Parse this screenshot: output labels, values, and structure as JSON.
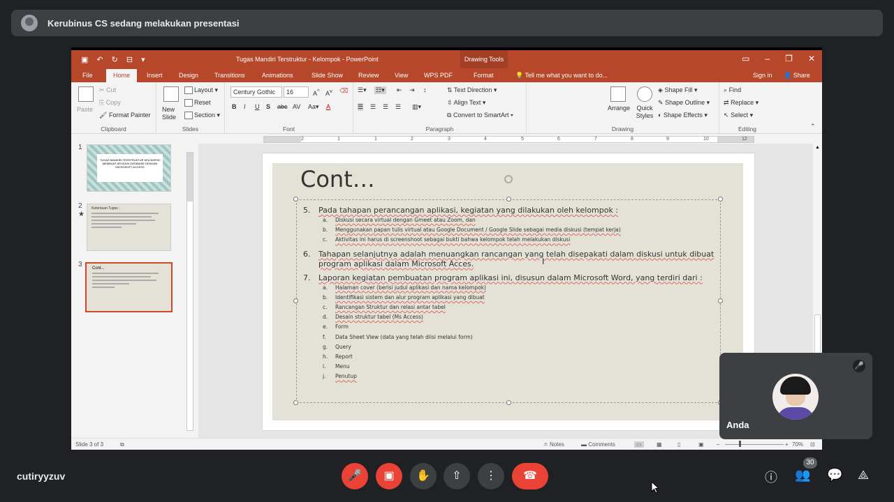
{
  "meet": {
    "presenting_banner": "Kerubinus CS sedang melakukan presentasi",
    "self_name": "Anda",
    "user_label": "cutiryyzuv",
    "participants_count": "30"
  },
  "ppt": {
    "doc_title": "Tugas Mandiri Terstruktur - Kelompok - PowerPoint",
    "context_tab": "Drawing Tools",
    "tabs": [
      "File",
      "Home",
      "Insert",
      "Design",
      "Transitions",
      "Animations",
      "Slide Show",
      "Review",
      "View",
      "WPS PDF",
      "Format"
    ],
    "tell_me": "Tell me what you want to do...",
    "sign_in": "Sign in",
    "share": "Share",
    "ribbon": {
      "paste": "Paste",
      "cut": "Cut",
      "copy": "Copy",
      "format_painter": "Format Painter",
      "clipboard": "Clipboard",
      "new_slide": "New Slide",
      "layout": "Layout",
      "reset": "Reset",
      "section": "Section",
      "slides": "Slides",
      "font_name": "Century Gothic",
      "font_size": "16",
      "font": "Font",
      "text_direction": "Text Direction",
      "align_text": "Align Text",
      "convert_smartart": "Convert to SmartArt",
      "paragraph": "Paragraph",
      "arrange": "Arrange",
      "quick_styles": "Quick Styles",
      "shape_fill": "Shape Fill",
      "shape_outline": "Shape Outline",
      "shape_effects": "Shape Effects",
      "drawing": "Drawing",
      "find": "Find",
      "replace": "Replace",
      "select": "Select",
      "editing": "Editing"
    },
    "ruler_numbers": [
      "2",
      "1",
      "1",
      "2",
      "3",
      "4",
      "5",
      "6",
      "7",
      "8",
      "9",
      "10",
      "11",
      "12"
    ],
    "thumbnails": {
      "numbers": [
        "1",
        "2",
        "3"
      ],
      "t1_text": "TUGAS MANDIRI TERSTRUKTUR KELOMPOK MEMBUAT APLIKASI DATABASE DENGAN MICROSOFT ACCESS",
      "t2_title": "Ketentuan Tugas :",
      "t3_title": "Cont..."
    },
    "slide": {
      "title": "Cont…",
      "items": [
        {
          "num": "5.",
          "text": "Pada tahapan perancangan aplikasi, kegiatan yang dilakukan oleh kelompok :",
          "subs": [
            {
              "num": "a.",
              "text": "Diskusi secara virtual dengan Gmeet atau Zoom, dan"
            },
            {
              "num": "b.",
              "text": "Menggunakan papan tulis virtual atau Google Document / Google Slide sebagai media diskusi (tempat kerja)"
            },
            {
              "num": "c.",
              "text": "Aktivitas ini harus di screenshoot sebagai bukti bahwa kelompok telah melakukan diskusi"
            }
          ]
        },
        {
          "num": "6.",
          "text": "Tahapan selanjutnya adalah menuangkan rancangan yang telah disepakati dalam diskusi untuk dibuat program aplikasi dalam Microsoft Acces.",
          "subs": []
        },
        {
          "num": "7.",
          "text": "Laporan kegiatan pembuatan program aplikasi ini, disusun dalam Microsoft Word, yang terdiri dari :",
          "subs": [
            {
              "num": "a.",
              "text": "Halaman cover (berisi judul aplikasi dan nama kelompok)"
            },
            {
              "num": "b.",
              "text": "Identifikasi sistem dan alur program aplikasi yang dibuat"
            },
            {
              "num": "c.",
              "text": "Rancangan Struktur dan relasi antar tabel"
            },
            {
              "num": "d.",
              "text": "Desain struktur tabel  (Ms Access)"
            },
            {
              "num": "e.",
              "text": "Form"
            },
            {
              "num": "f.",
              "text": "Data Sheet View (data yang telah diisi melalui form)"
            },
            {
              "num": "g.",
              "text": "Query"
            },
            {
              "num": "h.",
              "text": "Report"
            },
            {
              "num": "i.",
              "text": "Menu"
            },
            {
              "num": "j.",
              "text": "Penutup"
            }
          ]
        }
      ]
    },
    "status": {
      "slide_of": "Slide 3 of 3",
      "notes": "Notes",
      "comments": "Comments",
      "zoom": "70%"
    }
  },
  "colors": {
    "ppt_accent": "#b7472a",
    "meet_bg": "#202124",
    "hangup_red": "#ea4335"
  }
}
